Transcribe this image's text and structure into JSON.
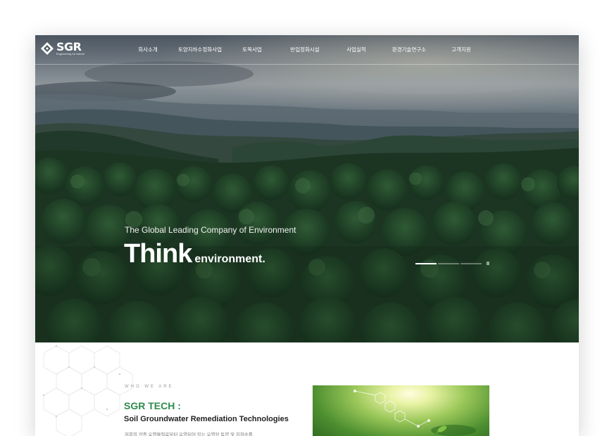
{
  "brand": {
    "name": "SGR",
    "tagline": "Engineering for Nature"
  },
  "nav": {
    "items": [
      {
        "label": "회사소개"
      },
      {
        "label": "토양지하수정화사업"
      },
      {
        "label": "토목사업"
      },
      {
        "label": "반입정화시설"
      },
      {
        "label": "사업실적"
      },
      {
        "label": "환경기술연구소"
      },
      {
        "label": "고객지원"
      }
    ]
  },
  "hero": {
    "tagline": "The Global Leading Company of Environment",
    "headline_big": "Think",
    "headline_small": "environment.",
    "slides_total": 3,
    "active_slide": 1,
    "pause_symbol": "II"
  },
  "about": {
    "eyebrow": "WHO WE ARE",
    "title": "SGR TECH :",
    "subtitle": "Soil Groundwater Remediation Technologies",
    "description": "저희의 각종 오염물질로부터 오염되어 있는 오염된 토양 및 지하수를"
  },
  "colors": {
    "accent_green": "#2e8b4d",
    "forest_dark": "#132a1b"
  },
  "icons": {
    "logo": "sgr-logo-icon",
    "pause": "pause-icon"
  }
}
